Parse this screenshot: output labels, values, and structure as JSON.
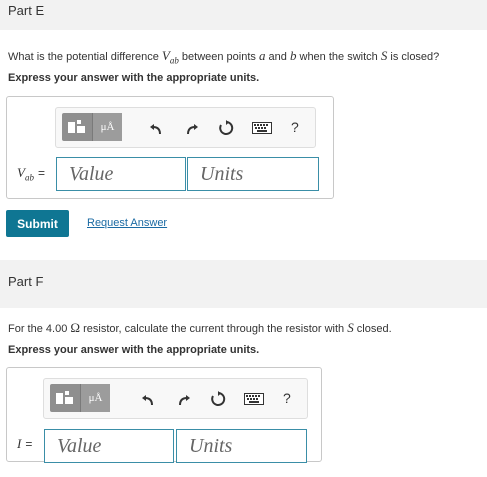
{
  "partE": {
    "header": "Part E",
    "question_pre": "What is the potential difference ",
    "question_var": "V",
    "question_var_sub": "ab",
    "question_mid1": " between points ",
    "question_a": "a",
    "question_mid2": " and ",
    "question_b": "b",
    "question_mid3": " when the switch ",
    "question_s": "S",
    "question_post": " is closed?",
    "instruction": "Express your answer with the appropriate units.",
    "var_label": "V",
    "var_sub": "ab",
    "eq": "=",
    "value_placeholder": "Value",
    "units_placeholder": "Units",
    "submit_label": "Submit",
    "request_label": "Request Answer"
  },
  "partF": {
    "header": "Part F",
    "question_pre": "For the 4.00 ",
    "question_ohm": "Ω",
    "question_mid": " resistor, calculate the current through the resistor with ",
    "question_s": "S",
    "question_post": " closed.",
    "instruction": "Express your answer with the appropriate units.",
    "var_label": "I",
    "eq": "=",
    "value_placeholder": "Value",
    "units_placeholder": "Units"
  },
  "toolbar": {
    "units_button": "μÅ",
    "help": "?",
    "icons": [
      "templates-icon",
      "units-icon",
      "undo-icon",
      "redo-icon",
      "reset-icon",
      "keyboard-icon",
      "help-icon"
    ]
  },
  "colors": {
    "header_bg": "#f2f2f2",
    "submit_bg": "#0f7693",
    "field_border": "#3a8ea7",
    "link": "#1a6aa3"
  }
}
